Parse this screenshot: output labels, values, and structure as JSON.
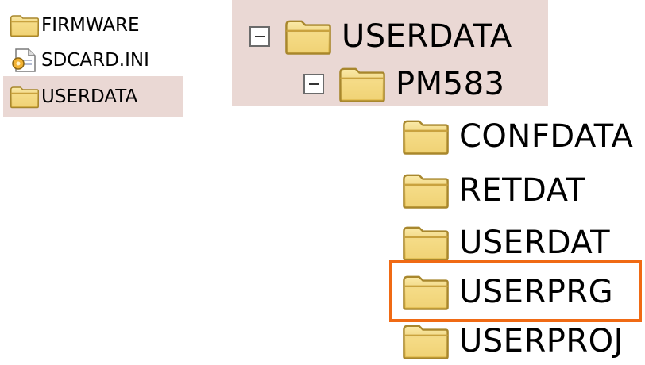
{
  "small_tree": {
    "items": [
      {
        "label": "FIRMWARE",
        "icon": "folder-icon"
      },
      {
        "label": "SDCARD.INI",
        "icon": "ini-file-icon"
      },
      {
        "label": "USERDATA",
        "icon": "folder-icon",
        "selected": true
      }
    ]
  },
  "large_tree": {
    "root": {
      "label": "USERDATA",
      "expanded": true
    },
    "child": {
      "label": "PM583",
      "expanded": true
    },
    "folders": [
      {
        "label": "CONFDATA"
      },
      {
        "label": "RETDAT"
      },
      {
        "label": "USERDAT"
      },
      {
        "label": "USERPRG",
        "highlighted": true
      },
      {
        "label": "USERPROJ"
      }
    ]
  },
  "colors": {
    "selection_bg": "#ead8d4",
    "highlight_border": "#f06a14",
    "folder_fill": "#f3d680",
    "folder_outline": "#a8872d"
  }
}
